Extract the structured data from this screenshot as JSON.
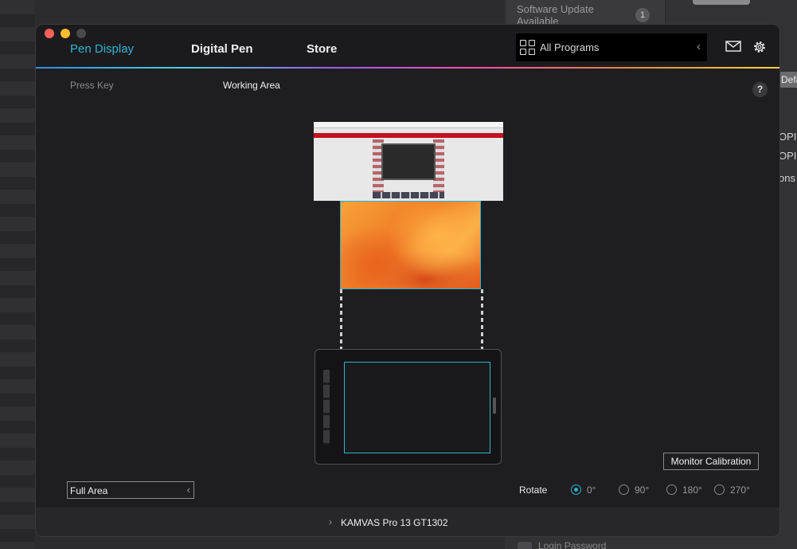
{
  "background": {
    "update_label": "Software Update Available",
    "update_count": "1",
    "right_snippets": [
      "Defa",
      "OPI",
      "OPI",
      "ons"
    ],
    "bottom_row": "Login Password"
  },
  "nav": {
    "tabs": [
      {
        "label": "Pen Display",
        "active": true
      },
      {
        "label": "Digital Pen",
        "active": false
      },
      {
        "label": "Store",
        "active": false
      }
    ],
    "program_select": {
      "value": "All Programs",
      "icon": "grid-icon"
    },
    "icons": [
      "mail-icon",
      "gear-icon"
    ]
  },
  "subtabs": [
    {
      "label": "Press Key",
      "active": false
    },
    {
      "label": "Working Area",
      "active": true
    }
  ],
  "help_label": "?",
  "calibration_label": "Monitor Calibration",
  "area_select": {
    "value": "Full Area"
  },
  "rotate": {
    "label": "Rotate",
    "options": [
      "0°",
      "90°",
      "180°",
      "270°"
    ],
    "selected": "0°"
  },
  "device_label": "KAMVAS Pro 13 GT1302",
  "colors": {
    "accent": "#2fb5d6",
    "window_bg": "#1e1e20"
  }
}
